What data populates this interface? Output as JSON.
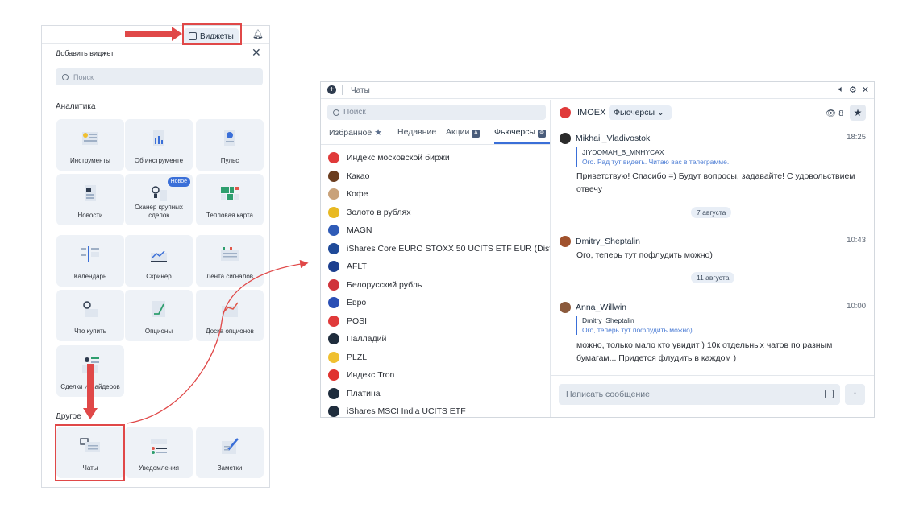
{
  "left_panel": {
    "widgets_button": "Виджеты",
    "add_widget_title": "Добавить виджет",
    "search_placeholder": "Поиск",
    "section_analytics": "Аналитика",
    "section_other": "Другое",
    "new_badge": "Новое",
    "tiles": [
      {
        "label": "Инструменты"
      },
      {
        "label": "Об инструменте"
      },
      {
        "label": "Пульс"
      },
      {
        "label": "Новости"
      },
      {
        "label": "Сканер крупных сделок"
      },
      {
        "label": "Тепловая карта"
      },
      {
        "label": "Календарь"
      },
      {
        "label": "Скринер"
      },
      {
        "label": "Лента сигналов"
      },
      {
        "label": "Что купить"
      },
      {
        "label": "Опционы"
      },
      {
        "label": "Доска опционов"
      },
      {
        "label": "Сделки инсайдеров"
      },
      {
        "label": "Чаты"
      },
      {
        "label": "Уведомления"
      },
      {
        "label": "Заметки"
      }
    ]
  },
  "chat_panel": {
    "title": "Чаты",
    "search_placeholder": "Поиск",
    "tabs": [
      {
        "label": "Избранное"
      },
      {
        "label": "Недавние"
      },
      {
        "label": "Акции"
      },
      {
        "label": "Фьючерсы"
      }
    ],
    "instruments": [
      {
        "name": "Индекс московской биржи",
        "color": "#e03a3a"
      },
      {
        "name": "Какао",
        "color": "#6b3d1f"
      },
      {
        "name": "Кофе",
        "color": "#c9a27a"
      },
      {
        "name": "Золото в рублях",
        "color": "#e8b923"
      },
      {
        "name": "MAGN",
        "color": "#2f5bb7"
      },
      {
        "name": "iShares Core EURO STOXX 50 UCITS ETF EUR (Dist)",
        "color": "#1f4a99"
      },
      {
        "name": "AFLT",
        "color": "#1c3f8f"
      },
      {
        "name": "Белорусский рубль",
        "color": "#d0343c"
      },
      {
        "name": "Евро",
        "color": "#2a4fb5"
      },
      {
        "name": "POSI",
        "color": "#e03a3a"
      },
      {
        "name": "Палладий",
        "color": "#1f2d3d"
      },
      {
        "name": "PLZL",
        "color": "#f0c030"
      },
      {
        "name": "Индекс Tron",
        "color": "#e0332f"
      },
      {
        "name": "Платина",
        "color": "#1f2d3d"
      },
      {
        "name": "iShares MSCI India UCITS ETF",
        "color": "#1f2d3d"
      }
    ],
    "header": {
      "instrument": "IMOEX",
      "chip": "Фьючерсы",
      "viewers": "8"
    },
    "messages": [
      {
        "user": "Mikhail_Vladivostok",
        "time": "18:25",
        "avatar_color": "#2b2b2b",
        "quote_author": "JIYDOMAH_B_MNHYCAX",
        "quote_text": "Ого. Рад тут видеть. Читаю вас в телеграмме.",
        "text": "Приветствую! Спасибо =) Будут вопросы, задавайте! С удовольствием отвечу"
      },
      {
        "user": "Dmitry_Sheptalin",
        "time": "10:43",
        "avatar_color": "#a0522d",
        "text": "Ого, теперь тут пофлудить можно)"
      },
      {
        "user": "Anna_Willwin",
        "time": "10:00",
        "avatar_color": "#8b5a3c",
        "quote_author": "Dmitry_Sheptalin",
        "quote_text": "Ого, теперь тут пофлудить можно)",
        "text": "можно, только мало кто увидит ) 10к отдельных чатов по разным бумагам... Придется флудить в каждом )"
      }
    ],
    "dates": [
      "7 августа",
      "11 августа"
    ],
    "composer_placeholder": "Написать сообщение"
  }
}
